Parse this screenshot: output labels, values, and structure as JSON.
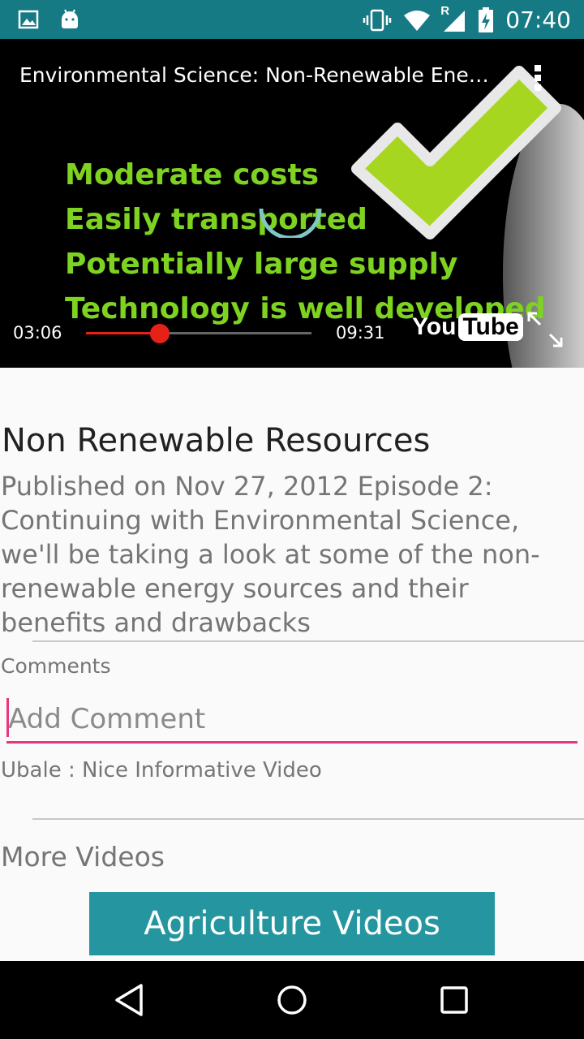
{
  "status_bar": {
    "time": "07:40",
    "left_icons": [
      "image-icon",
      "android-icon"
    ],
    "right_icons": [
      "vibrate-icon",
      "wifi-icon",
      "signal-icon",
      "battery-charging-icon"
    ],
    "signal_roaming_label": "R",
    "background": "#157a84"
  },
  "player": {
    "title": "Environmental Science: Non-Renewable Energy",
    "slide_lines": [
      "Moderate costs",
      "Easily transported",
      "Potentially large supply",
      "Technology is well developed"
    ],
    "current_time": "03:06",
    "duration": "09:31",
    "progress_fraction": 0.326,
    "logo_you": "You",
    "logo_tube": "Tube",
    "accent": "#e62117"
  },
  "video": {
    "title": "Non Renewable Resources",
    "description": "Published on Nov 27, 2012  Episode 2: Continuing with Environmental Science, we'll be taking a look at some of the non-renewable energy sources and their benefits and drawbacks"
  },
  "comments": {
    "label": "Comments",
    "input_placeholder": "Add Comment",
    "input_value": "",
    "items": [
      "Ubale : Nice Informative Video"
    ]
  },
  "more_videos": {
    "label": "More Videos",
    "button_label": "Agriculture Videos",
    "button_color": "#2596a0"
  },
  "nav_bar": {
    "buttons": [
      "back-icon",
      "home-icon",
      "recents-icon"
    ]
  }
}
